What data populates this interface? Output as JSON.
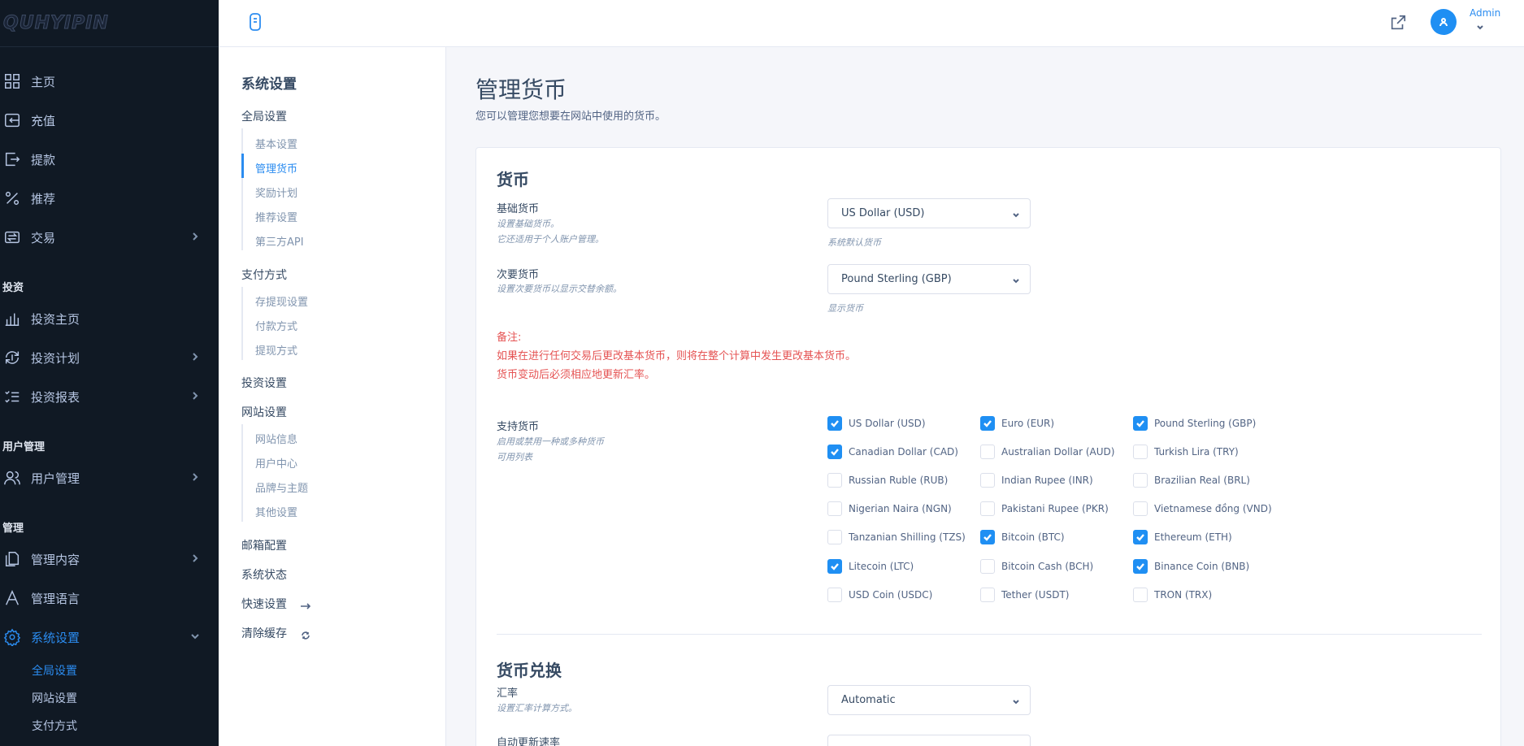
{
  "brand": {
    "logo": "QUHYIPIN"
  },
  "header": {
    "user_name": "Admin"
  },
  "sidebar": {
    "items": [
      {
        "label": "主页",
        "icon": "grid-icon"
      },
      {
        "label": "充值",
        "icon": "deposit-icon"
      },
      {
        "label": "提款",
        "icon": "withdraw-icon"
      },
      {
        "label": "推荐",
        "icon": "percent-icon"
      },
      {
        "label": "交易",
        "icon": "exchange-icon"
      }
    ],
    "invest_heading": "投资",
    "invest_items": [
      {
        "label": "投资主页",
        "icon": "chart-bars-icon"
      },
      {
        "label": "投资计划",
        "icon": "refresh-dollar-icon"
      },
      {
        "label": "投资报表",
        "icon": "list-check-icon"
      }
    ],
    "user_heading": "用户管理",
    "user_items": [
      {
        "label": "用户管理",
        "icon": "users-icon"
      }
    ],
    "manage_heading": "管理",
    "manage_items": [
      {
        "label": "管理内容",
        "icon": "files-icon"
      },
      {
        "label": "管理语言",
        "icon": "language-icon"
      },
      {
        "label": "系统设置",
        "icon": "gear-icon"
      }
    ],
    "sub_items": [
      {
        "label": "全局设置"
      },
      {
        "label": "网站设置"
      },
      {
        "label": "支付方式"
      }
    ]
  },
  "settings_nav": {
    "title": "系统设置",
    "global": "全局设置",
    "global_items": [
      "基本设置",
      "管理货币",
      "奖励计划",
      "推荐设置",
      "第三方API"
    ],
    "payment": "支付方式",
    "payment_items": [
      "存提现设置",
      "付款方式",
      "提现方式"
    ],
    "invest": "投资设置",
    "site": "网站设置",
    "site_items": [
      "网站信息",
      "用户中心",
      "品牌与主题",
      "其他设置"
    ],
    "mail": "邮箱配置",
    "status": "系统状态",
    "quick": "快速设置",
    "cache": "清除缓存"
  },
  "page": {
    "title": "管理货币",
    "subtitle": "您可以管理您想要在网站中使用的货币。"
  },
  "currency": {
    "section_title": "货币",
    "base_label": "基础货币",
    "base_note_1": "设置基础货币。",
    "base_note_2": "它还适用于个人账户管理。",
    "base_value": "US Dollar (USD)",
    "base_hint": "系统默认货币",
    "secondary_label": "次要货币",
    "secondary_note": "设置次要货币以显示交替余额。",
    "secondary_value": "Pound Sterling (GBP)",
    "secondary_hint": "显示货币",
    "warn_1": "备注:",
    "warn_2": "如果在进行任何交易后更改基本货币，则将在整个计算中发生更改基本货币。",
    "warn_3": "货币变动后必须相应地更新汇率。",
    "supported_label": "支持货币",
    "supported_note_1": "启用或禁用一种或多种货币",
    "supported_note_2": "可用列表",
    "options": [
      {
        "label": "US Dollar (USD)",
        "checked": true
      },
      {
        "label": "Euro (EUR)",
        "checked": true
      },
      {
        "label": "Pound Sterling (GBP)",
        "checked": true
      },
      {
        "label": "Canadian Dollar (CAD)",
        "checked": true
      },
      {
        "label": "Australian Dollar (AUD)",
        "checked": false
      },
      {
        "label": "Turkish Lira (TRY)",
        "checked": false
      },
      {
        "label": "Russian Ruble (RUB)",
        "checked": false
      },
      {
        "label": "Indian Rupee (INR)",
        "checked": false
      },
      {
        "label": "Brazilian Real (BRL)",
        "checked": false
      },
      {
        "label": "Nigerian Naira (NGN)",
        "checked": false
      },
      {
        "label": "Pakistani Rupee (PKR)",
        "checked": false
      },
      {
        "label": "Vietnamese đồng (VND)",
        "checked": false
      },
      {
        "label": "Tanzanian Shilling (TZS)",
        "checked": false
      },
      {
        "label": "Bitcoin (BTC)",
        "checked": true
      },
      {
        "label": "Ethereum (ETH)",
        "checked": true
      },
      {
        "label": "Litecoin (LTC)",
        "checked": true
      },
      {
        "label": "Bitcoin Cash (BCH)",
        "checked": false
      },
      {
        "label": "Binance Coin (BNB)",
        "checked": true
      },
      {
        "label": "USD Coin (USDC)",
        "checked": false
      },
      {
        "label": "Tether (USDT)",
        "checked": false
      },
      {
        "label": "TRON (TRX)",
        "checked": false
      }
    ]
  },
  "exchange": {
    "section_title": "货币兑换",
    "rate_label": "汇率",
    "rate_note": "设置汇率计算方式。",
    "rate_value": "Automatic",
    "auto_label": "自动更新速率"
  }
}
